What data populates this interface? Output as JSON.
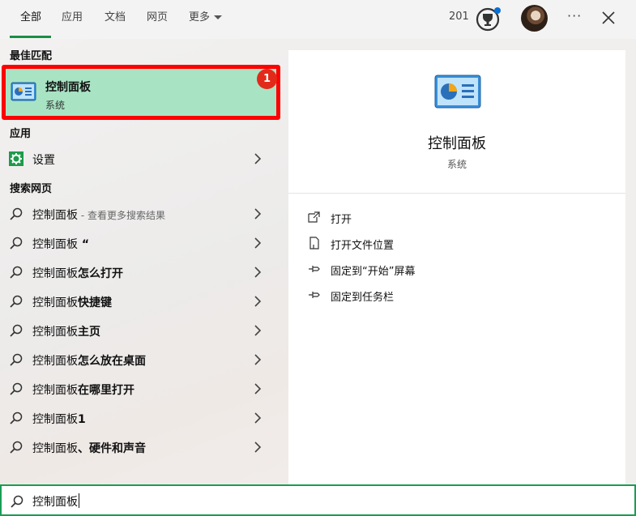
{
  "tabs": [
    {
      "label": "全部"
    },
    {
      "label": "应用"
    },
    {
      "label": "文档"
    },
    {
      "label": "网页"
    },
    {
      "label": "更多"
    }
  ],
  "header": {
    "points": "201",
    "more_symbol": "···"
  },
  "left": {
    "best_match_heading": "最佳匹配",
    "best_match": {
      "title": "控制面板",
      "subtitle": "系统",
      "badge": "1"
    },
    "apps_heading": "应用",
    "apps": [
      {
        "label": "设置"
      }
    ],
    "web_heading": "搜索网页",
    "web_results": [
      {
        "prefix": "控制面板",
        "bold": "",
        "hint": " - 查看更多搜索结果"
      },
      {
        "prefix": "控制面板",
        "bold": " “",
        "hint": ""
      },
      {
        "prefix": "控制面板",
        "bold": "怎么打开",
        "hint": ""
      },
      {
        "prefix": "控制面板",
        "bold": "快捷键",
        "hint": ""
      },
      {
        "prefix": "控制面板",
        "bold": "主页",
        "hint": ""
      },
      {
        "prefix": "控制面板",
        "bold": "怎么放在桌面",
        "hint": ""
      },
      {
        "prefix": "控制面板",
        "bold": "在哪里打开",
        "hint": ""
      },
      {
        "prefix": "控制面板",
        "bold": "1",
        "hint": ""
      },
      {
        "prefix": "控制面板",
        "bold": "、硬件和声音",
        "hint": ""
      }
    ]
  },
  "right": {
    "title": "控制面板",
    "subtitle": "系统",
    "actions": [
      {
        "label": "打开",
        "icon": "open-icon"
      },
      {
        "label": "打开文件位置",
        "icon": "file-location-icon"
      },
      {
        "label": "固定到“开始”屏幕",
        "icon": "pin-icon"
      },
      {
        "label": "固定到任务栏",
        "icon": "pin-icon"
      }
    ]
  },
  "search": {
    "value": "控制面板"
  },
  "colors": {
    "accent": "#1a8f44",
    "highlight_bg": "#a8e4c4",
    "annotation_red": "#ff0000"
  }
}
